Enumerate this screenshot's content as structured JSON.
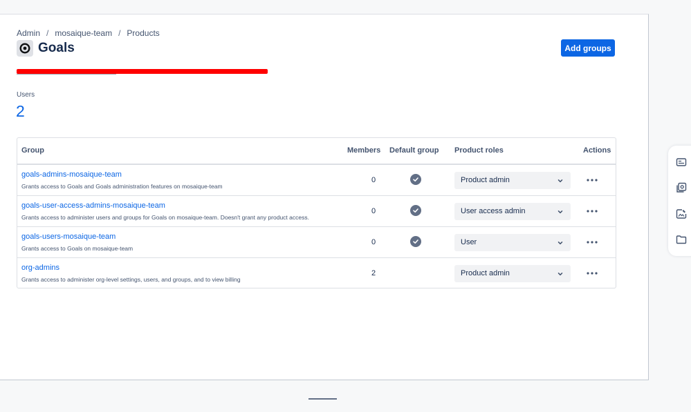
{
  "breadcrumb": {
    "items": [
      "Admin",
      "mosaique-team",
      "Products"
    ],
    "separator": "/"
  },
  "page": {
    "title": "Goals",
    "product_icon": "target-icon"
  },
  "actions": {
    "add_groups_label": "Add groups"
  },
  "stats": {
    "users_label": "Users",
    "users_count": "2"
  },
  "table": {
    "headers": {
      "group": "Group",
      "members": "Members",
      "default_group": "Default group",
      "product_roles": "Product roles",
      "actions": "Actions"
    },
    "rows": [
      {
        "name": "goals-admins-mosaique-team",
        "description": "Grants access to Goals and Goals administration features on mosaique-team",
        "members": "0",
        "default_group": true,
        "role": "Product admin"
      },
      {
        "name": "goals-user-access-admins-mosaique-team",
        "description": "Grants access to administer users and groups for Goals on mosaique-team. Doesn't grant any product access.",
        "members": "0",
        "default_group": true,
        "role": "User access admin"
      },
      {
        "name": "goals-users-mosaique-team",
        "description": "Grants access to Goals on mosaique-team",
        "members": "0",
        "default_group": true,
        "role": "User"
      },
      {
        "name": "org-admins",
        "description": "Grants access to administer org-level settings, users, and groups, and to view billing",
        "members": "2",
        "default_group": false,
        "role": "Product admin"
      }
    ]
  },
  "right_rail": {
    "icons": [
      "id-card-icon",
      "gallery-icon",
      "image-edit-icon",
      "folder-icon"
    ]
  },
  "colors": {
    "accent": "#0c66e4",
    "redaction": "#ff0000",
    "check": "#626f86",
    "text": "#172b4d",
    "subtle_text": "#44546f"
  }
}
